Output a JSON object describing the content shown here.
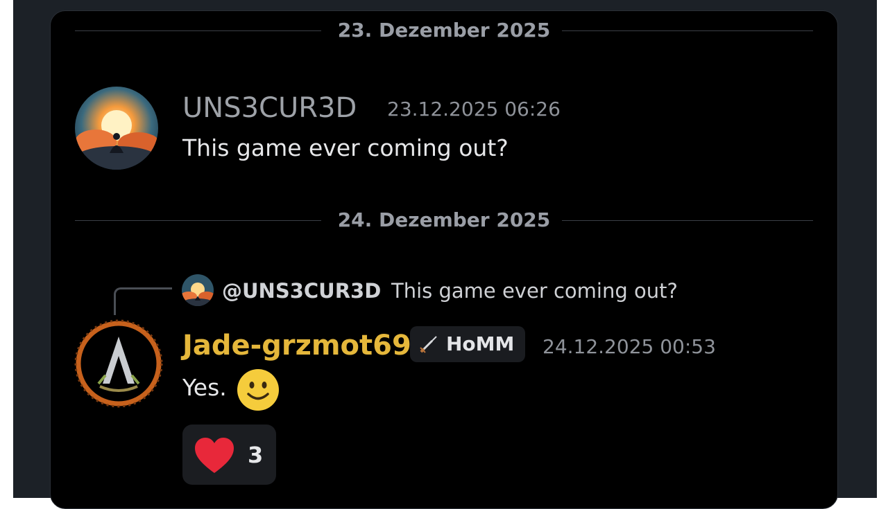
{
  "dividers": {
    "first": "23. Dezember 2025",
    "second": "24. Dezember 2025"
  },
  "message1": {
    "username": "UNS3CUR3D",
    "timestamp": "23.12.2025 06:26",
    "text": "This game ever coming out?",
    "avatar_icon": "sunset-meditation-avatar"
  },
  "reply": {
    "mention": "@UNS3CUR3D",
    "quoted_text": "This game ever coming out?"
  },
  "message2": {
    "username": "Jade-grzmot69",
    "username_color": "#e5b73b",
    "tag_label": "HoMM",
    "tag_icon": "crossed-swords-icon",
    "timestamp": "24.12.2025 00:53",
    "text": "Yes.",
    "emoji": "slightly-smiling-face-emoji",
    "avatar_icon": "assassin-emblem-avatar"
  },
  "reaction": {
    "emoji": "red-heart-icon",
    "count": "3"
  },
  "colors": {
    "background": "#000000",
    "frame": "#1c2127",
    "accent": "#e5b73b"
  }
}
